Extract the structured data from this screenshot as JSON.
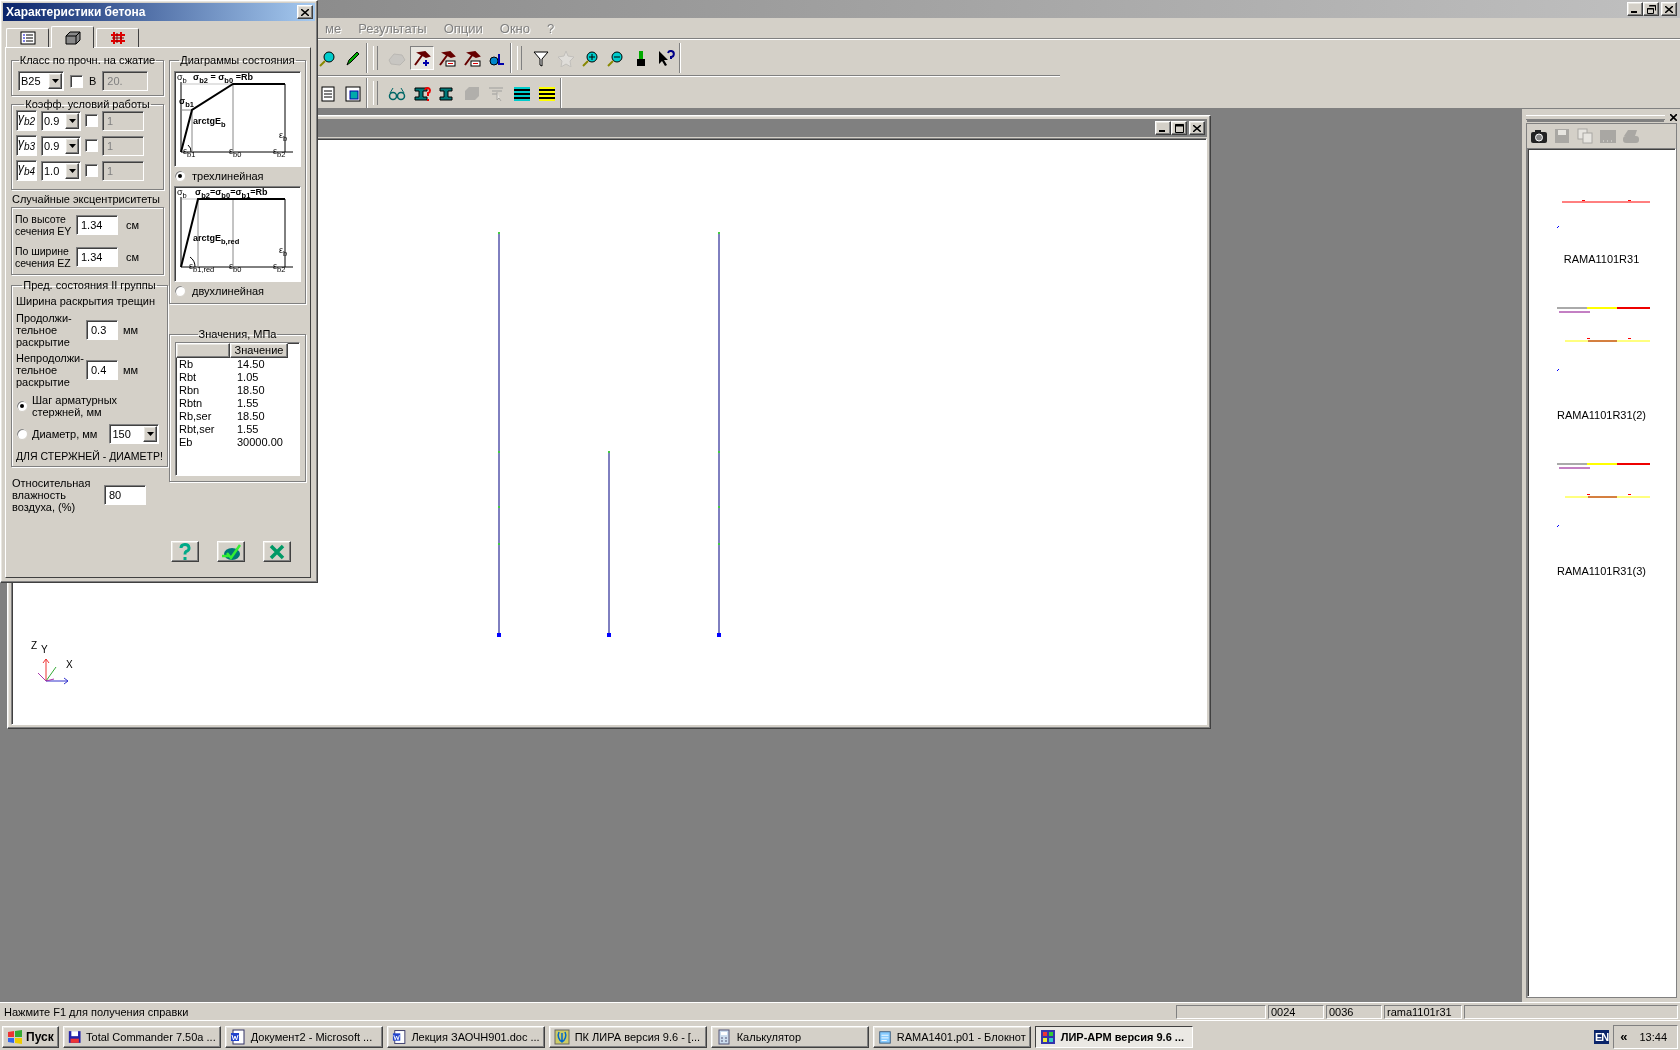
{
  "menu": [
    {
      "label": "ме",
      "disabled": true
    },
    {
      "label": "Результаты",
      "disabled": true
    },
    {
      "label": "Опции",
      "disabled": true
    },
    {
      "label": "Окно",
      "disabled": true
    },
    {
      "label": "?",
      "disabled": true
    }
  ],
  "toolbars": [
    [
      {
        "kind": "magnifier",
        "pressed": false,
        "disabled": false
      },
      {
        "kind": "pencil",
        "pressed": false,
        "disabled": false
      },
      {
        "kind": "sep"
      },
      {
        "kind": "hands",
        "pressed": false,
        "disabled": true
      },
      {
        "kind": "hammer_plus",
        "pressed": true,
        "disabled": false
      },
      {
        "kind": "hammer_minus",
        "pressed": false,
        "disabled": false
      },
      {
        "kind": "hammer_edit",
        "pressed": false,
        "disabled": false
      },
      {
        "kind": "element",
        "pressed": false,
        "disabled": false
      },
      {
        "kind": "sep"
      },
      {
        "kind": "funnel",
        "pressed": false,
        "disabled": false
      },
      {
        "kind": "star",
        "pressed": false,
        "disabled": true
      },
      {
        "kind": "zoom_in",
        "pressed": false,
        "disabled": false
      },
      {
        "kind": "zoom_out",
        "pressed": false,
        "disabled": false
      },
      {
        "kind": "brush",
        "pressed": false,
        "disabled": false
      },
      {
        "kind": "help_cursor",
        "pressed": false,
        "disabled": false
      }
    ],
    [
      {
        "kind": "page",
        "pressed": false,
        "disabled": false
      },
      {
        "kind": "window_select",
        "pressed": false,
        "disabled": false
      },
      {
        "kind": "sep"
      },
      {
        "kind": "glasses",
        "pressed": false,
        "disabled": false
      },
      {
        "kind": "beam_question",
        "pressed": false,
        "disabled": false
      },
      {
        "kind": "beam",
        "pressed": false,
        "disabled": false
      },
      {
        "kind": "block",
        "pressed": false,
        "disabled": true
      },
      {
        "kind": "cursor_table",
        "pressed": false,
        "disabled": true
      },
      {
        "kind": "layers",
        "pressed": false,
        "disabled": false
      },
      {
        "kind": "layers_yellow",
        "pressed": false,
        "disabled": false
      }
    ]
  ],
  "axes": [
    "Z",
    "Y",
    "X"
  ],
  "dialog": {
    "title": "Характеристики бетона",
    "tabs": [
      {
        "kind": "list",
        "selected": false
      },
      {
        "kind": "cube",
        "selected": true
      },
      {
        "kind": "grid",
        "selected": false
      }
    ],
    "strength_class": {
      "legend": "Класс по прочн. на сжатие",
      "value": "B25",
      "checked": false,
      "check_label": "B",
      "field_value": "20."
    },
    "work_conditions": {
      "legend": "Коэфф. условий работы",
      "rows": [
        {
          "symbol": "γ$_{b2}$",
          "value": "0.9",
          "checked": false,
          "field_value": "1"
        },
        {
          "symbol": "γ$_{b3}$",
          "value": "0.9",
          "checked": false,
          "field_value": "1"
        },
        {
          "symbol": "γ$_{b4}$",
          "value": "1.0",
          "checked": false,
          "field_value": "1"
        }
      ]
    },
    "eccentricities": {
      "heading": "Случайные эксцентриситеты",
      "rows": [
        {
          "label": "По высоте сечения EY",
          "value": "1.34",
          "unit": "см"
        },
        {
          "label": "По ширине сечения EZ",
          "value": "1.34",
          "unit": "см"
        }
      ]
    },
    "limit_states": {
      "legend": "Пред. состояния II группы",
      "subheading": "Ширина раскрытия трещин",
      "rows": [
        {
          "label": "Продолжи-тельное раскрытие",
          "value": "0.3",
          "unit": "мм"
        },
        {
          "label": "Непродолжи-тельное раскрытие",
          "value": "0.4",
          "unit": "мм"
        }
      ],
      "options": [
        {
          "label": "Шаг арматурных стержней, мм",
          "selected": true
        },
        {
          "label": "Диаметр, мм",
          "selected": false
        }
      ],
      "combo_value": "150",
      "note": "ДЛЯ СТЕРЖНЕЙ - ДИАМЕТР!"
    },
    "humidity": {
      "label": "Относительная влажность воздуха, (%)",
      "value": "80"
    },
    "diagrams": {
      "legend": "Диаграммы состояния",
      "items": [
        {
          "kind": "trilinear",
          "label": "трехлинейная",
          "selected": true,
          "texts": [
            "σ$_{b}$",
            "σ$_{b2}$ = σ$_{b0}$ =Rb",
            "σ$_{b1}$",
            "arctgE$_{b}$",
            "ε$_{b}$",
            "ε$_{b1}$",
            "ε$_{b0}$",
            "ε$_{b2}$"
          ]
        },
        {
          "kind": "bilinear",
          "label": "двухлинейная",
          "selected": false,
          "texts": [
            "σ$_{b}$",
            "σ$_{b2}$=σ$_{b0}$=σ$_{b1}$=Rb",
            "arctgE$_{b,red}$",
            "ε$_{b}$",
            "ε$_{b1,red}$",
            "ε$_{b0}$",
            "ε$_{b2}$"
          ]
        }
      ]
    },
    "values": {
      "legend": "Значения, МПа",
      "column": "Значение",
      "rows": [
        {
          "name": "Rb",
          "value": "14.50"
        },
        {
          "name": "Rbt",
          "value": "1.05"
        },
        {
          "name": "Rbn",
          "value": "18.50"
        },
        {
          "name": "Rbtn",
          "value": "1.55"
        },
        {
          "name": "Rb,ser",
          "value": "18.50"
        },
        {
          "name": "Rbt,ser",
          "value": "1.55"
        },
        {
          "name": "Eb",
          "value": "30000.00"
        }
      ]
    },
    "buttons": [
      {
        "kind": "help"
      },
      {
        "kind": "ok"
      },
      {
        "kind": "cancel"
      }
    ]
  },
  "panel_tools": [
    {
      "kind": "camera",
      "disabled": false
    },
    {
      "kind": "save",
      "disabled": true
    },
    {
      "kind": "copy",
      "disabled": true
    },
    {
      "kind": "dots",
      "disabled": true
    },
    {
      "kind": "printer",
      "disabled": true
    }
  ],
  "thumbnails": [
    {
      "name": "RAMA1101R31"
    },
    {
      "name": "RAMA1101R31(2)"
    },
    {
      "name": "RAMA1101R31(3)"
    }
  ],
  "status_bar": {
    "message": "Нажмите F1 для получения справки",
    "panes": [
      "0024",
      "0036",
      "rama1101r31"
    ]
  },
  "taskbar": {
    "start": "Пуск",
    "tasks": [
      {
        "kind": "floppy",
        "label": "Total Commander 7.50a ...",
        "selected": false
      },
      {
        "kind": "word",
        "label": "Документ2 - Microsoft ...",
        "selected": false
      },
      {
        "kind": "word",
        "label": "Лекция ЗАОЧН901.doc ...",
        "selected": false
      },
      {
        "kind": "lyre",
        "label": "ПК ЛИРА  версия 9.6 - [...",
        "selected": false
      },
      {
        "kind": "calculator",
        "label": "Калькулятор",
        "selected": false
      },
      {
        "kind": "notepad",
        "label": "RAMA1401.p01 - Блокнот",
        "selected": false
      },
      {
        "kind": "app",
        "label": "ЛИР-АРМ версия 9.6  ...",
        "selected": true
      }
    ],
    "language": "EN",
    "expand": "«",
    "clock": "13:44"
  }
}
